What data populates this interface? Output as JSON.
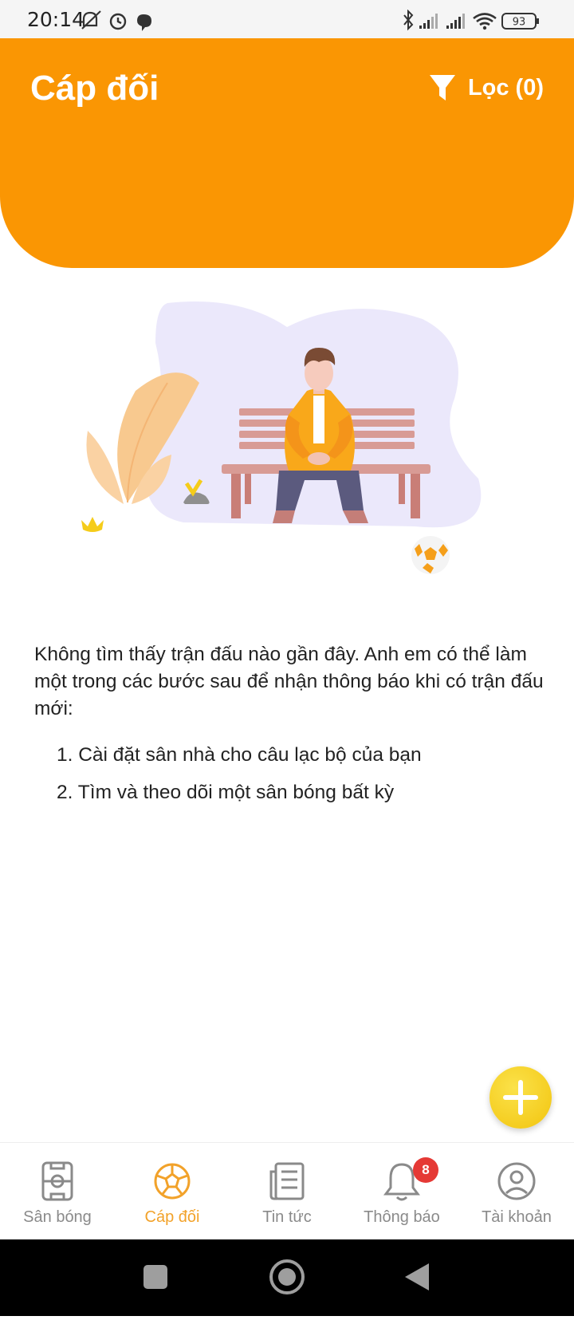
{
  "status_bar": {
    "time": "20:14",
    "battery": "93"
  },
  "header": {
    "title": "Cáp đối",
    "filter_label": "Lọc (0)"
  },
  "empty_state": {
    "message": "Không tìm thấy trận đấu nào gần đây. Anh em có thể làm một trong các bước sau để nhận thông báo khi có trận đấu mới:",
    "steps": [
      "1. Cài đặt sân nhà cho câu lạc bộ của bạn",
      "2. Tìm và theo dõi một sân bóng bất kỳ"
    ]
  },
  "bottom_nav": {
    "items": [
      {
        "label": "Sân bóng",
        "icon": "field-icon"
      },
      {
        "label": "Cáp đối",
        "icon": "soccer-ball-icon",
        "active": true
      },
      {
        "label": "Tin tức",
        "icon": "news-icon"
      },
      {
        "label": "Thông báo",
        "icon": "bell-icon",
        "badge": "8"
      },
      {
        "label": "Tài khoản",
        "icon": "account-icon"
      }
    ]
  },
  "colors": {
    "accent": "#fa9603",
    "fab": "#f5c918",
    "active_nav": "#f2a22a",
    "badge": "#e53935"
  }
}
